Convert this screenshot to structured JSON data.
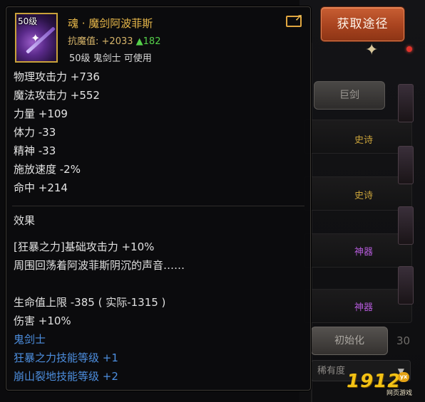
{
  "acquire_button": {
    "label": "获取途径"
  },
  "item": {
    "level_badge": "50级",
    "name": "魂 · 魔剑阿波菲斯",
    "resist": {
      "label": "抗魔值:",
      "value": "+2033",
      "increase": "▲182"
    },
    "requirement": "50级 鬼剑士 可使用"
  },
  "stats": [
    "物理攻击力 +736",
    "魔法攻击力 +552",
    "力量 +109",
    "体力 -33",
    "精神 -33",
    "施放速度 -2%",
    "命中 +214"
  ],
  "effect": {
    "header": "效果",
    "lines": [
      "[狂暴之力]基础攻击力 +10%",
      "周围回荡着阿波菲斯阴沉的声音……"
    ],
    "extra": [
      "生命值上限 -385 ( 实际-1315 )",
      "伤害 +10%"
    ],
    "class_name": "鬼剑士",
    "skill_bonuses": [
      "狂暴之力技能等级 +1",
      "崩山裂地技能等级 +2"
    ]
  },
  "background": {
    "sword_button": "巨剑",
    "tags": [
      "史诗",
      "史诗",
      "神器",
      "神器"
    ],
    "init_button": "初始化",
    "filter": "稀有度",
    "side_number": "30"
  },
  "watermark": {
    "number": "1912",
    "badge": "yx",
    "subtitle": "网页游戏"
  },
  "colors": {
    "title_gold": "#e8b84a",
    "accent_orange": "#b14a22",
    "skill_blue": "#4d8fe0",
    "increase_green": "#55d04a"
  }
}
